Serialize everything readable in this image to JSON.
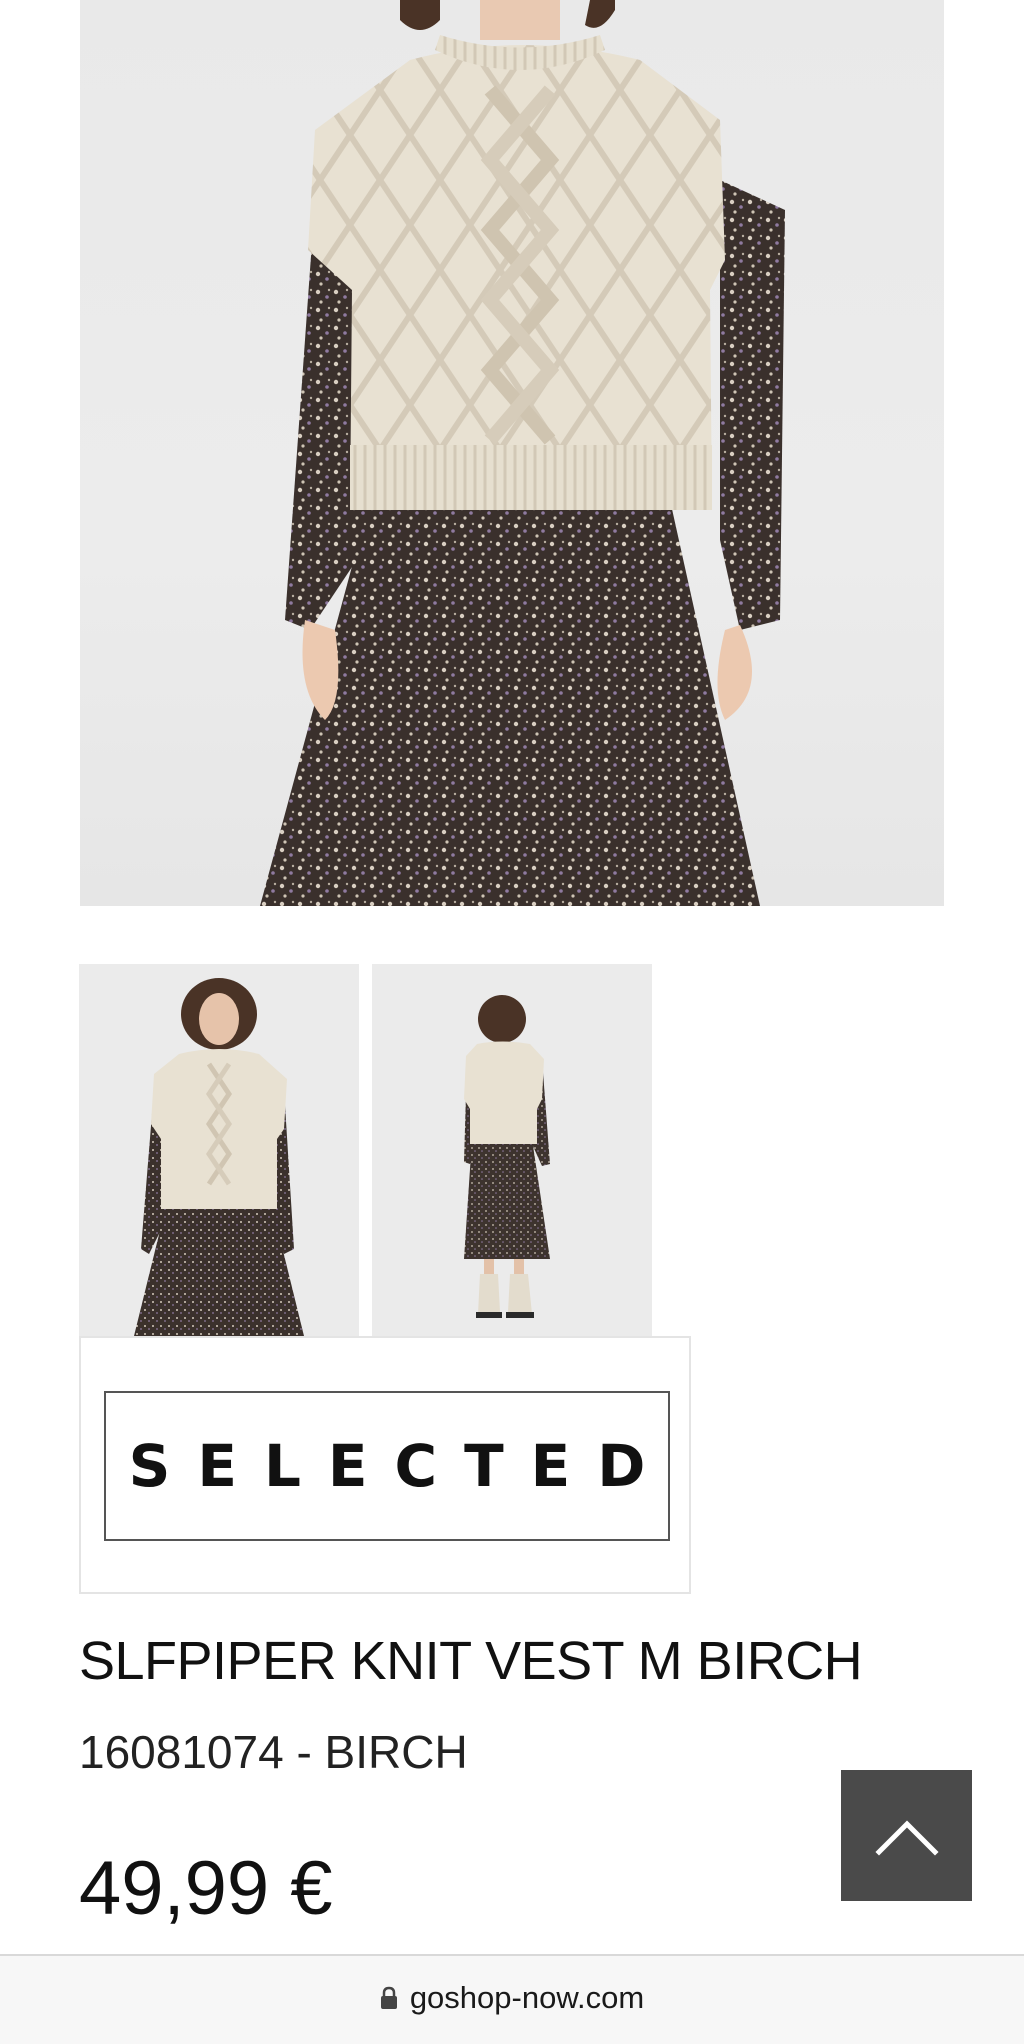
{
  "brand": {
    "logo_text": "SELECTED"
  },
  "product": {
    "title": "SLFPIPER KNIT VEST M BIRCH",
    "sku": "16081074 - BIRCH",
    "price": "49,99 €"
  },
  "gallery": {
    "thumbnails": [
      "front-view",
      "back-view"
    ]
  },
  "controls": {
    "back_to_top_icon": "chevron-up-icon"
  },
  "browser": {
    "url": "goshop-now.com",
    "lock_icon": "lock-icon"
  },
  "colors": {
    "back_to_top_bg": "#4a4a4a",
    "vest": "#e8e1d2",
    "dress": "#3a302c"
  }
}
